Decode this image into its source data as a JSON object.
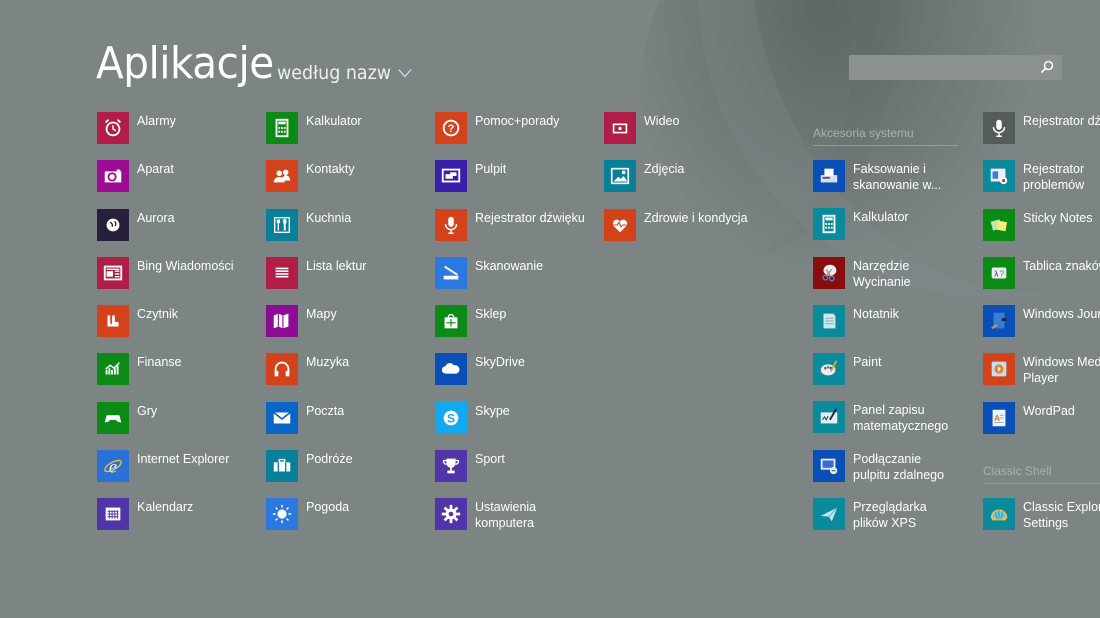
{
  "header": {
    "title": "Aplikacje",
    "sort_label": "według nazw"
  },
  "search": {
    "value": "",
    "placeholder": ""
  },
  "columns": [
    [
      {
        "label": "Alarmy",
        "icon": "alarm-clock-icon",
        "color": "#b01e47"
      },
      {
        "label": "Aparat",
        "icon": "camera-icon",
        "color": "#9d0a94"
      },
      {
        "label": "Aurora",
        "icon": "globe-icon",
        "color": "#281f3a"
      },
      {
        "label": "Bing Wiadomości",
        "icon": "news-icon",
        "color": "#b01e47"
      },
      {
        "label": "Czytnik",
        "icon": "reader-icon",
        "color": "#d4421c"
      },
      {
        "label": "Finanse",
        "icon": "chart-icon",
        "color": "#0c8a16"
      },
      {
        "label": "Gry",
        "icon": "gamepad-icon",
        "color": "#0c8a16"
      },
      {
        "label": "Internet Explorer",
        "icon": "ie-icon",
        "color": "#2a70d6"
      },
      {
        "label": "Kalendarz",
        "icon": "calendar-icon",
        "color": "#5134a8"
      }
    ],
    [
      {
        "label": "Kalkulator",
        "icon": "calculator-icon",
        "color": "#0c8a16"
      },
      {
        "label": "Kontakty",
        "icon": "people-icon",
        "color": "#d4421c"
      },
      {
        "label": "Kuchnia",
        "icon": "fork-spoon-icon",
        "color": "#08809a"
      },
      {
        "label": "Lista lektur",
        "icon": "reading-list-icon",
        "color": "#b01e47"
      },
      {
        "label": "Mapy",
        "icon": "map-icon",
        "color": "#8c0d93"
      },
      {
        "label": "Muzyka",
        "icon": "headphones-icon",
        "color": "#d4421c"
      },
      {
        "label": "Poczta",
        "icon": "mail-icon",
        "color": "#0a66c6"
      },
      {
        "label": "Podróże",
        "icon": "suitcase-icon",
        "color": "#08809a"
      },
      {
        "label": "Pogoda",
        "icon": "sun-icon",
        "color": "#2a78e0"
      }
    ],
    [
      {
        "label": "Pomoc+porady",
        "icon": "help-icon",
        "color": "#d4421c"
      },
      {
        "label": "Pulpit",
        "icon": "desktop-icon",
        "color": "#3a1fa8"
      },
      {
        "label": "Rejestrator dźwięku",
        "icon": "microphone-icon",
        "color": "#d4421c"
      },
      {
        "label": "Skanowanie",
        "icon": "scanner-icon",
        "color": "#2a78e0"
      },
      {
        "label": "Sklep",
        "icon": "store-icon",
        "color": "#0c8a16"
      },
      {
        "label": "SkyDrive",
        "icon": "cloud-icon",
        "color": "#0a4fb8"
      },
      {
        "label": "Skype",
        "icon": "skype-icon",
        "color": "#12a9ef"
      },
      {
        "label": "Sport",
        "icon": "trophy-icon",
        "color": "#5134a8"
      },
      {
        "label": "Ustawienia\nkomputera",
        "icon": "gear-icon",
        "color": "#5134a8"
      }
    ],
    [
      {
        "label": "Wideo",
        "icon": "video-icon",
        "color": "#b01e47"
      },
      {
        "label": "Zdjęcia",
        "icon": "photos-icon",
        "color": "#08809a"
      },
      {
        "label": "Zdrowie i kondycja",
        "icon": "heart-icon",
        "color": "#d4421c"
      }
    ]
  ],
  "groups": [
    {
      "title": "Akcesoria systemu",
      "items": [
        {
          "label": "Faksowanie i\nskanowanie w...",
          "icon": "fax-icon",
          "color": "#0a4fb8"
        },
        {
          "label": "Kalkulator",
          "icon": "calculator-icon",
          "color": "#0a8a9a"
        },
        {
          "label": "Narzędzie\nWycinanie",
          "icon": "scissors-icon",
          "color": "#8a0d0d"
        },
        {
          "label": "Notatnik",
          "icon": "notepad-icon",
          "color": "#0a8a9a"
        },
        {
          "label": "Paint",
          "icon": "palette-icon",
          "color": "#0a8a9a"
        },
        {
          "label": "Panel zapisu\nmatematycznego",
          "icon": "math-input-icon",
          "color": "#0a8a9a"
        },
        {
          "label": "Podłączanie\npulpitu zdalnego",
          "icon": "remote-desktop-icon",
          "color": "#0a4fb8"
        },
        {
          "label": "Przeglądarka\nplików XPS",
          "icon": "xps-icon",
          "color": "#0a8a9a"
        }
      ]
    },
    {
      "title": "",
      "items": [
        {
          "label": "Rejestrator dźwięku",
          "icon": "microphone-icon",
          "color": "#555a5a"
        },
        {
          "label": "Rejestrator\nproblemów",
          "icon": "steps-recorder-icon",
          "color": "#0a8a9a"
        },
        {
          "label": "Sticky Notes",
          "icon": "sticky-notes-icon",
          "color": "#0c8a16"
        },
        {
          "label": "Tablica znaków",
          "icon": "charmap-icon",
          "color": "#0c8a16"
        },
        {
          "label": "Windows Journal",
          "icon": "journal-icon",
          "color": "#0a4fb8"
        },
        {
          "label": "Windows Media\nPlayer",
          "icon": "media-player-icon",
          "color": "#d4421c"
        },
        {
          "label": "WordPad",
          "icon": "wordpad-icon",
          "color": "#0a4fb8"
        }
      ]
    },
    {
      "title": "Classic Shell",
      "items": [
        {
          "label": "Classic Explorer\nSettings",
          "icon": "shell-icon",
          "color": "#0a8a9a"
        }
      ]
    }
  ]
}
